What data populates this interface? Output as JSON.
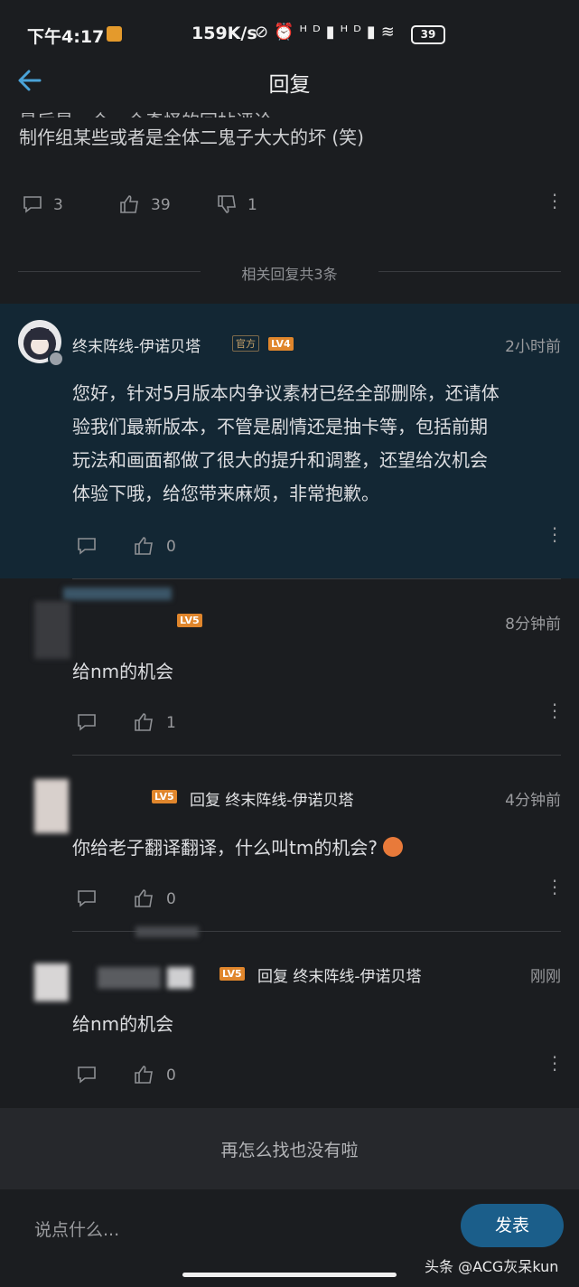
{
  "status_bar": {
    "time": "下午4:17",
    "speed": "159K/s",
    "icons": "⊘⏰ᴴᴰ▮ᴴᴰ▮≋",
    "battery": "39"
  },
  "header": {
    "title": "回复",
    "back_icon": "←"
  },
  "previous_post": {
    "partial_line": "最后是一个一个奇怪的回帖评论",
    "text": "制作组某些或者是全体二鬼子大大的坏 (笑)",
    "comments": "3",
    "likes": "39",
    "dislikes": "1"
  },
  "related_label": "相关回复共3条",
  "replies": [
    {
      "username": "终末阵线-伊诺贝塔",
      "official_tag": "官方",
      "level": "LV4",
      "time": "2小时前",
      "text_lines": [
        "您好，针对5月版本内争议素材已经全部删除，还请体",
        "验我们最新版本，不管是剧情还是抽卡等，包括前期",
        "玩法和画面都做了很大的提升和调整，还望给次机会",
        "体验下哦，给您带来麻烦，非常抱歉。"
      ],
      "likes": "0"
    },
    {
      "level": "LV5",
      "time": "8分钟前",
      "text": "给nm的机会",
      "likes": "1"
    },
    {
      "level": "LV5",
      "reply_to": "回复 终末阵线-伊诺贝塔",
      "time": "4分钟前",
      "text": "你给老子翻译翻译，什么叫tm的机会?",
      "likes": "0"
    },
    {
      "level": "LV5",
      "reply_to": "回复 终末阵线-伊诺贝塔",
      "time": "刚刚",
      "text": "给nm的机会",
      "likes": "0"
    }
  ],
  "end_text": "再怎么找也没有啦",
  "composer": {
    "placeholder": "说点什么...",
    "send_label": "发表"
  },
  "watermark": "头条 @ACG灰呆kun",
  "colors": {
    "accent": "#4aa3d8",
    "highlight_bg": "#132734",
    "send_btn": "#1b5e8a",
    "level_badge": "#e0862c"
  }
}
